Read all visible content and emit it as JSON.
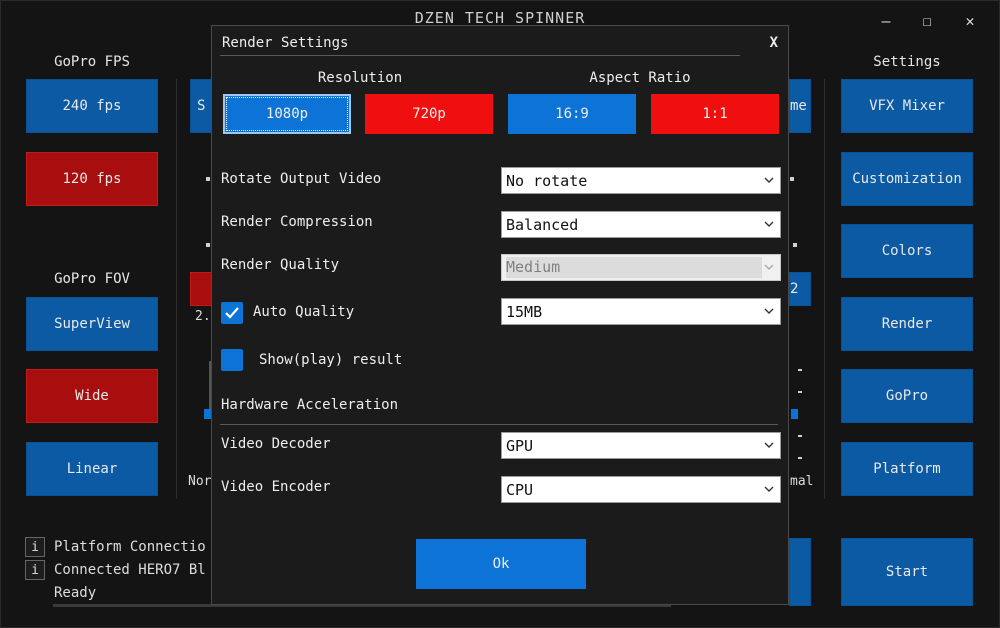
{
  "window": {
    "title": "DZEN TECH SPINNER",
    "controls": [
      "—",
      "☐",
      "✕"
    ]
  },
  "left": {
    "fps_label": "GoPro FPS",
    "fps_buttons": [
      "240 fps",
      "120 fps"
    ],
    "fov_label": "GoPro FOV",
    "fov_buttons": [
      "SuperView",
      "Wide",
      "Linear"
    ]
  },
  "right": {
    "settings_label": "Settings",
    "buttons": [
      "VFX Mixer",
      "Customization",
      "Colors",
      "Render",
      "GoPro",
      "Platform"
    ],
    "start_label": "Start"
  },
  "background_fragments": {
    "b1": "S",
    "b2": "me",
    "b3": "2.",
    "b4": "2",
    "nor": "Nor",
    "mal": "mal"
  },
  "status": {
    "lines": [
      {
        "icon": "i",
        "text": "Platform Connectio"
      },
      {
        "icon": "i",
        "text": "Connected HERO7 Bl"
      },
      {
        "icon": "",
        "text": "Ready"
      }
    ]
  },
  "modal": {
    "title": "Render Settings",
    "close": "X",
    "resolution_label": "Resolution",
    "aspect_label": "Aspect Ratio",
    "resolution_options": [
      "1080p",
      "720p"
    ],
    "aspect_options": [
      "16:9",
      "1:1"
    ],
    "rotate_label": "Rotate Output Video",
    "rotate_value": "No rotate",
    "compression_label": "Render Compression",
    "compression_value": "Balanced",
    "quality_label": "Render Quality",
    "quality_value": "Medium",
    "auto_quality_label": "Auto Quality",
    "auto_quality_checked": true,
    "size_value": "15MB",
    "show_result_label": "Show(play) result",
    "hw_label": "Hardware Acceleration",
    "decoder_label": "Video Decoder",
    "decoder_value": "GPU",
    "encoder_label": "Video Encoder",
    "encoder_value": "CPU",
    "ok_label": "Ok"
  },
  "colors": {
    "blue": "#0c5aa4",
    "red": "#a80e0e",
    "modal_blue": "#0e73d6",
    "modal_red": "#ef0f0f"
  }
}
